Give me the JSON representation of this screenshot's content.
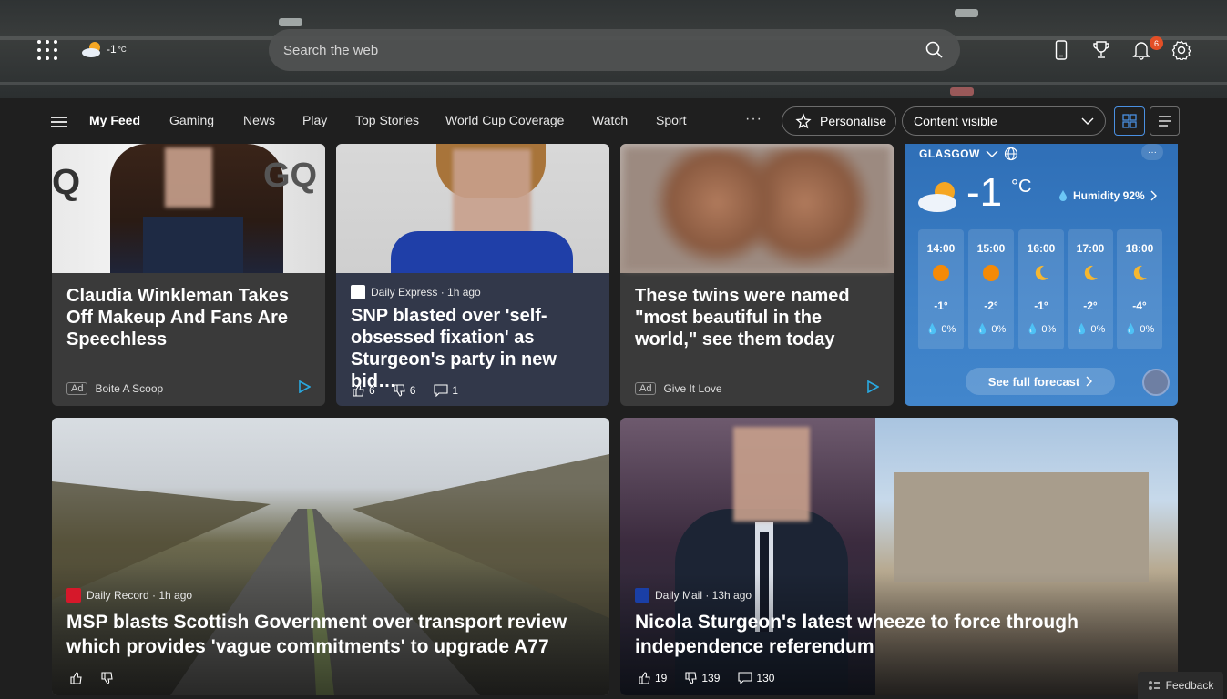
{
  "header": {
    "weather": {
      "temp": "-1",
      "unit": "°C"
    },
    "search": {
      "placeholder": "Search the web"
    },
    "notifications_count": "6"
  },
  "nav": {
    "items": [
      "My Feed",
      "Gaming",
      "News",
      "Play",
      "Top Stories",
      "World Cup Coverage",
      "Watch",
      "Sport"
    ],
    "more": "···",
    "personalise": "Personalise",
    "content_select": "Content visible"
  },
  "cards": {
    "claudia": {
      "title": "Claudia Winkleman Takes Off Makeup And Fans Are Speechless",
      "ad": "Ad",
      "source": "Boite A Scoop"
    },
    "snp": {
      "source": "Daily Express · 1h ago",
      "title": "SNP blasted over 'self-obsessed fixation' as Sturgeon's party in new bid…",
      "likes": "6",
      "dislikes": "6",
      "comments": "1"
    },
    "twins": {
      "title": "These twins were named \"most beautiful in the world,\" see them today",
      "ad": "Ad",
      "source": "Give It Love"
    },
    "msp": {
      "source": "Daily Record · 1h ago",
      "title": "MSP blasts Scottish Government over transport review which provides 'vague commitments' to upgrade A77"
    },
    "nicola": {
      "source": "Daily Mail · 13h ago",
      "title": "Nicola Sturgeon's latest wheeze to force through independence referendum",
      "likes": "19",
      "dislikes": "139",
      "comments": "130"
    }
  },
  "weather": {
    "location": "GLASGOW",
    "temp": "-1",
    "unit": "°C",
    "humidity": "Humidity 92%",
    "hours": [
      {
        "time": "14:00",
        "icon": "sun-icon",
        "temp": "-1°",
        "precip": "0%"
      },
      {
        "time": "15:00",
        "icon": "sun-icon",
        "temp": "-2°",
        "precip": "0%"
      },
      {
        "time": "16:00",
        "icon": "moon-icon",
        "temp": "-1°",
        "precip": "0%"
      },
      {
        "time": "17:00",
        "icon": "moon-icon",
        "temp": "-2°",
        "precip": "0%"
      },
      {
        "time": "18:00",
        "icon": "moon-icon",
        "temp": "-4°",
        "precip": "0%"
      }
    ],
    "forecast_button": "See full forecast"
  },
  "feedback": "Feedback",
  "colors": {
    "accent": "#4a90e2",
    "badge": "#e34f26",
    "weather_bg": "#3b7fc6",
    "card_bg": "#3a3a3a"
  }
}
